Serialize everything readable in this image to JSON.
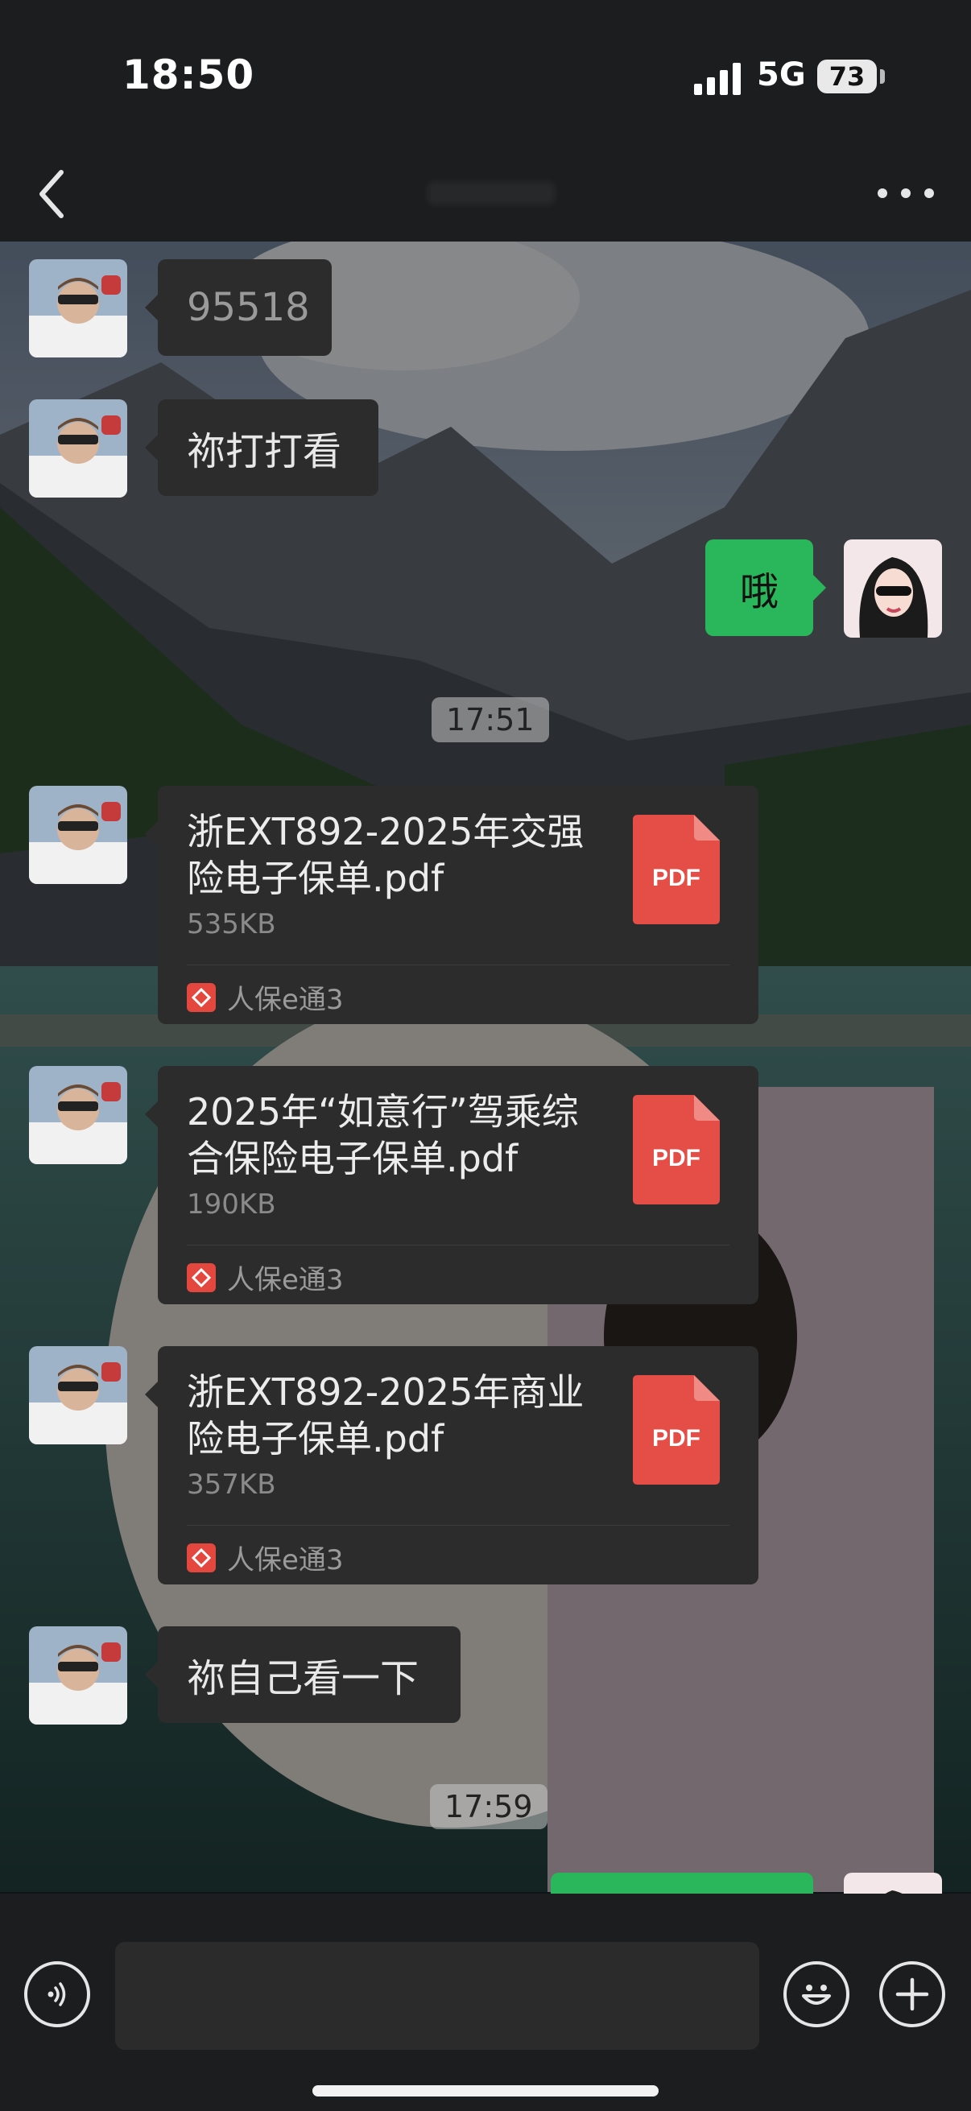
{
  "status_bar": {
    "time": "18:50",
    "network": "5G",
    "battery": "73"
  },
  "nav": {
    "back_icon": "chevron-left-icon",
    "more_icon": "ellipsis-icon"
  },
  "messages": {
    "m1": {
      "text": "95518",
      "side": "left"
    },
    "m2": {
      "text": "祢打打看",
      "side": "left"
    },
    "m3": {
      "text": "哦",
      "side": "right"
    },
    "ts1": "17:51",
    "file1": {
      "name": "浙EXT892-2025年交强险电子保单.pdf",
      "size": "535KB",
      "source": "人保e通3",
      "icon": "PDF"
    },
    "file2": {
      "name": "2025年“如意行”驾乘综合保险电子保单.pdf",
      "size": "190KB",
      "source": "人保e通3",
      "icon": "PDF"
    },
    "file3": {
      "name": "浙EXT892-2025年商业险电子保单.pdf",
      "size": "357KB",
      "source": "人保e通3",
      "icon": "PDF"
    },
    "m4": {
      "text": "祢自己看一下",
      "side": "left"
    },
    "ts2": "17:59"
  },
  "colors": {
    "my_bubble": "#2ab65a",
    "their_bubble": "#2c2c2c",
    "pdf_red": "#e54d47"
  },
  "input_bar": {
    "voice_icon": "voice-icon",
    "emoji_icon": "emoji-icon",
    "plus_icon": "plus-icon",
    "value": ""
  }
}
